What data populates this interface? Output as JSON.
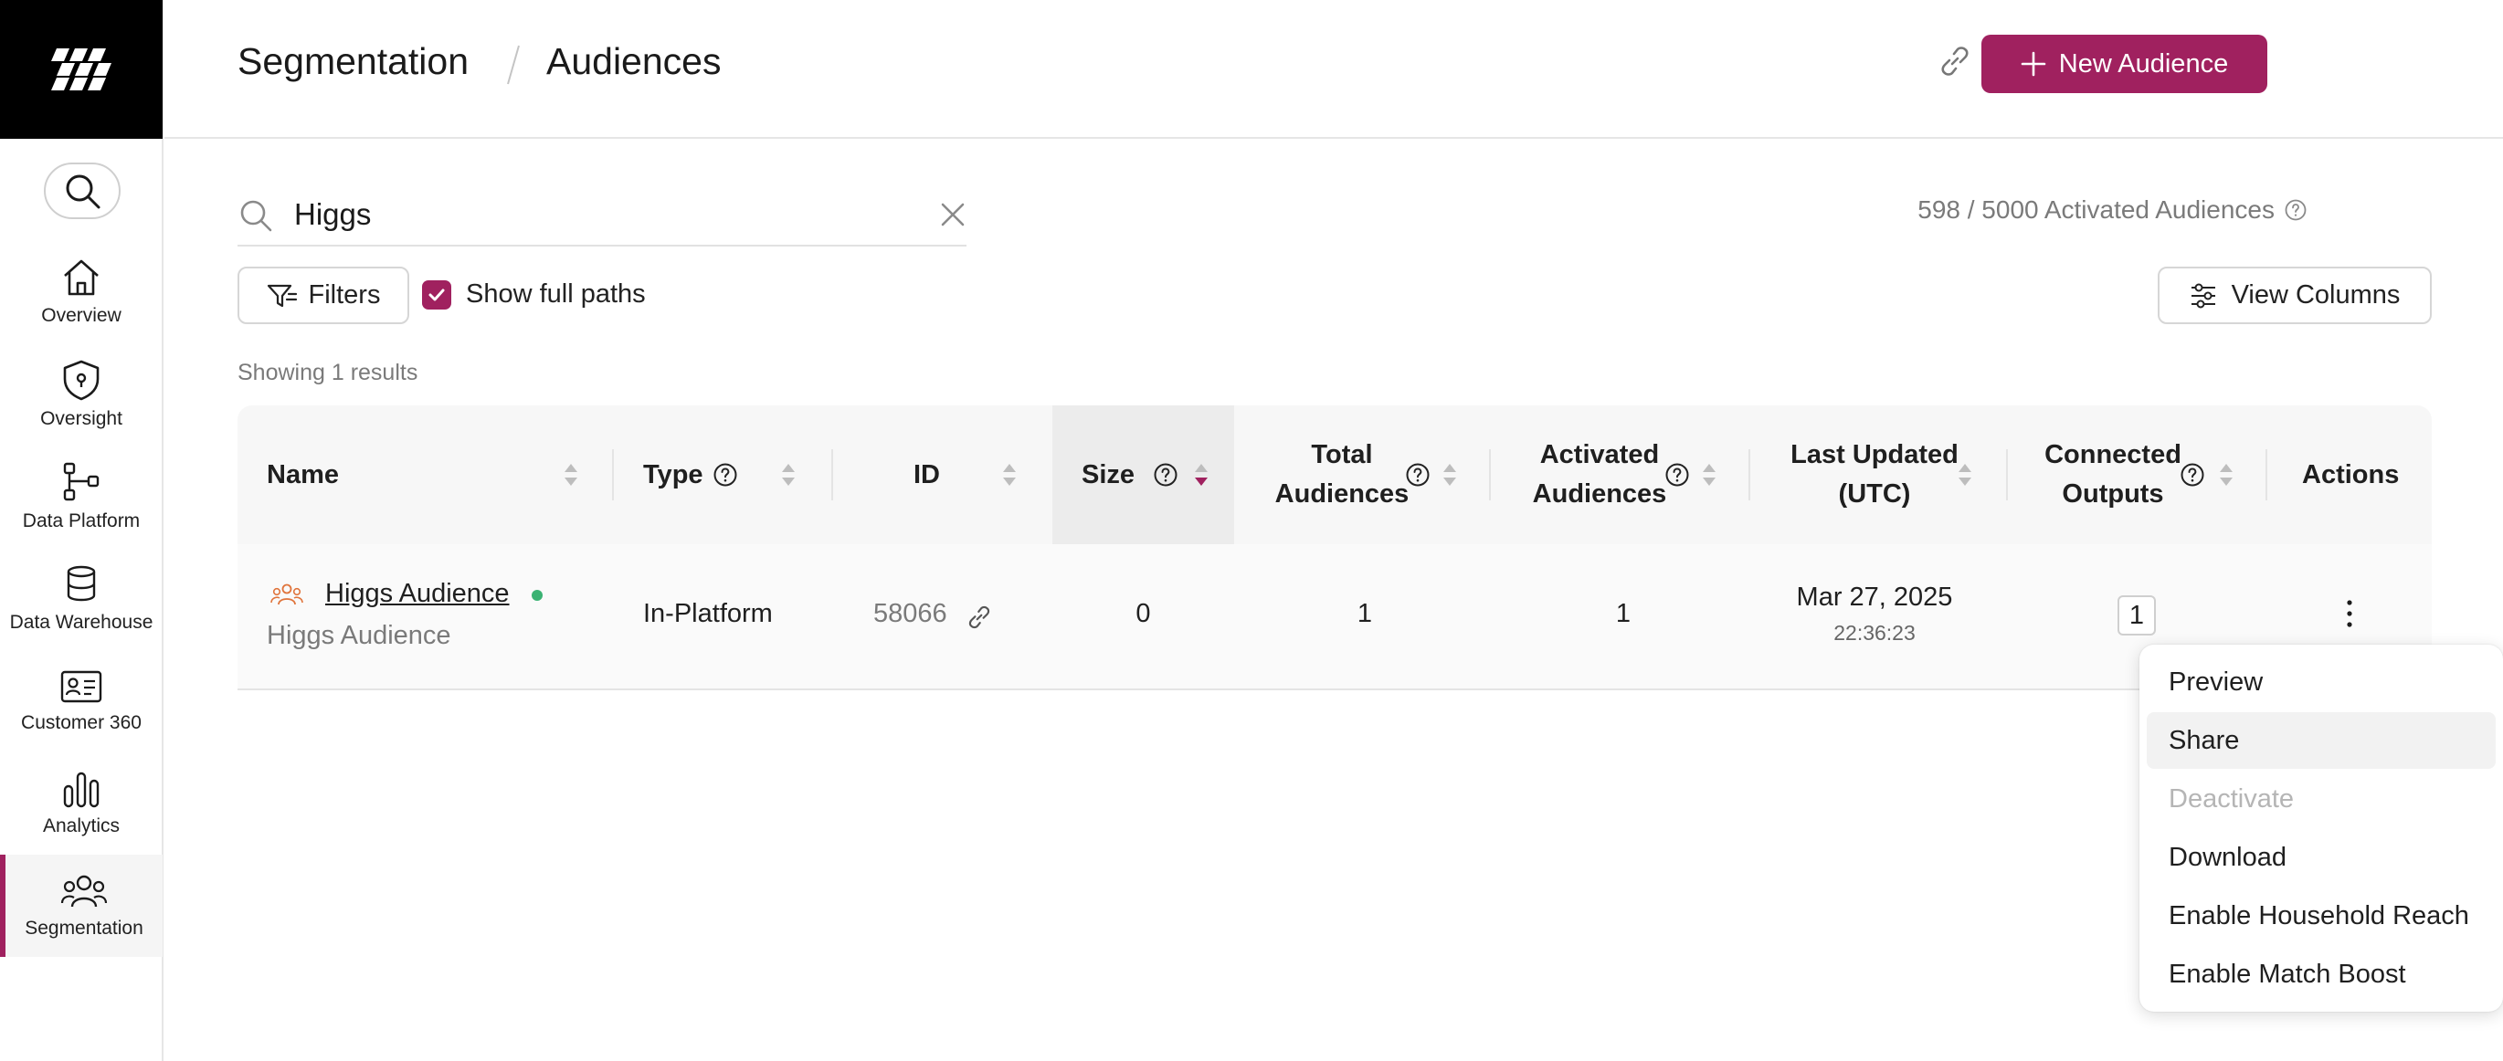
{
  "header": {
    "crumb_root": "Segmentation",
    "crumb_current": "Audiences",
    "new_audience_label": "New Audience"
  },
  "sidebar": {
    "items": [
      {
        "label": "Overview",
        "icon": "home-icon"
      },
      {
        "label": "Oversight",
        "icon": "shield-icon"
      },
      {
        "label": "Data Platform",
        "icon": "data-platform-icon"
      },
      {
        "label": "Data Warehouse",
        "icon": "database-icon"
      },
      {
        "label": "Customer 360",
        "icon": "id-card-icon"
      },
      {
        "label": "Analytics",
        "icon": "bar-chart-icon"
      },
      {
        "label": "Segmentation",
        "icon": "users-icon",
        "active": true
      }
    ]
  },
  "search": {
    "value": "Higgs",
    "activated_text": "598 / 5000 Activated Audiences"
  },
  "toolbar": {
    "filters_label": "Filters",
    "show_full_paths_label": "Show full paths",
    "show_full_paths_checked": true,
    "view_columns_label": "View Columns"
  },
  "results_text": "Showing 1 results",
  "table": {
    "columns": {
      "name": "Name",
      "type": "Type",
      "id": "ID",
      "size": "Size",
      "total_1": "Total",
      "total_2": "Audiences",
      "activated_1": "Activated",
      "activated_2": "Audiences",
      "updated_1": "Last Updated",
      "updated_2": "(UTC)",
      "connected_1": "Connected",
      "connected_2": "Outputs",
      "actions": "Actions"
    },
    "rows": [
      {
        "name": "Higgs Audience",
        "path": "Higgs Audience",
        "type": "In-Platform",
        "id": "58066",
        "size": "0",
        "total_audiences": "1",
        "activated_audiences": "1",
        "last_updated_date": "Mar 27, 2025",
        "last_updated_time": "22:36:23",
        "connected_outputs": "1"
      }
    ]
  },
  "menu": {
    "items": [
      {
        "label": "Preview"
      },
      {
        "label": "Share",
        "hovered": true
      },
      {
        "label": "Deactivate",
        "disabled": true
      },
      {
        "label": "Download"
      },
      {
        "label": "Enable Household Reach"
      },
      {
        "label": "Enable Match Boost"
      }
    ]
  },
  "colors": {
    "accent": "#a0215f",
    "status_active": "#3bb273",
    "audience_icon": "#e0743c"
  }
}
